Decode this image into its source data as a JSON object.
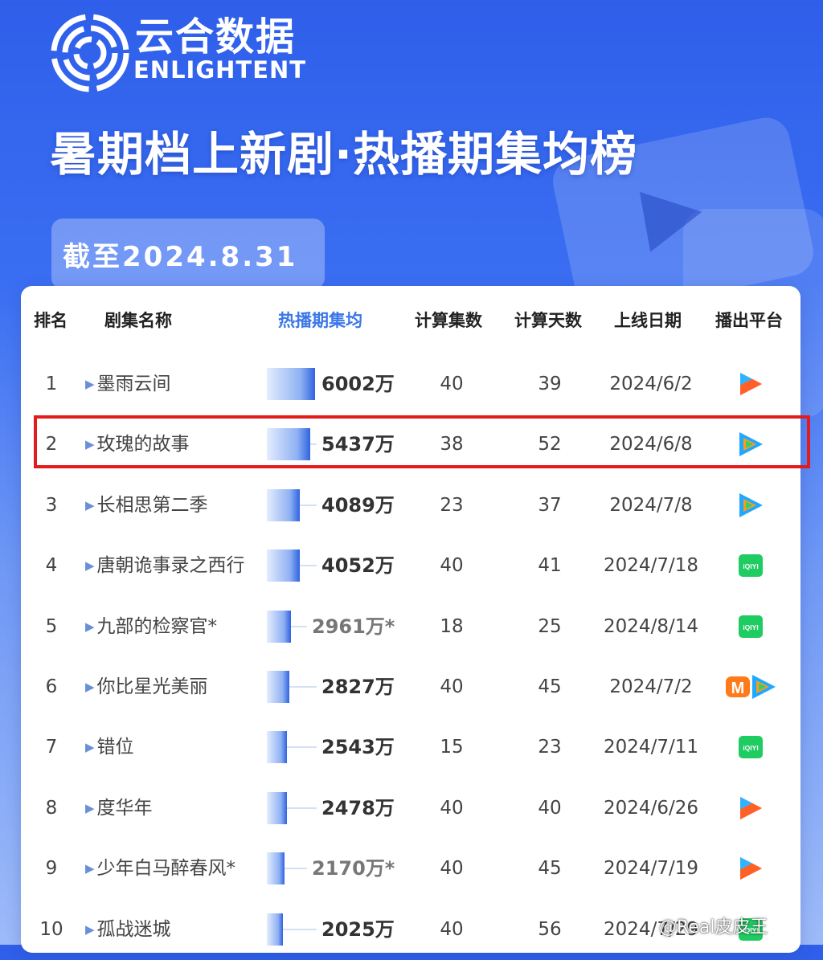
{
  "header": {
    "brand_cn": "云合数据",
    "brand_en": "ENLIGHTENT",
    "title": "暑期档上新剧·热播期集均榜",
    "date": "截至2024.8.31"
  },
  "columns": [
    "排名",
    "剧集名称",
    "热播期集均",
    "计算集数",
    "计算天数",
    "上线日期",
    "播出平台"
  ],
  "chart_data": {
    "type": "bar",
    "title": "暑期档上新剧·热播期集均榜",
    "value_column": "热播期集均",
    "unit": "万",
    "categories": [
      "墨雨云间",
      "玫瑰的故事",
      "长相思第二季",
      "唐朝诡事录之西行",
      "九部的检察官*",
      "你比星光美丽",
      "错位",
      "度华年",
      "少年白马醉春风*",
      "孤战迷城"
    ],
    "values": [
      6002,
      5437,
      4089,
      4052,
      2961,
      2827,
      2543,
      2478,
      2170,
      2025
    ],
    "value_labels": [
      "6002万",
      "5437万",
      "4089万",
      "4052万",
      "2961万*",
      "2827万",
      "2543万",
      "2478万",
      "2170万*",
      "2025万"
    ],
    "estimated": [
      false,
      false,
      false,
      false,
      true,
      false,
      false,
      false,
      true,
      false
    ],
    "ylim": [
      0,
      6002
    ]
  },
  "rows": [
    {
      "rank": "1",
      "name": "墨雨云间",
      "episodes": "40",
      "days": "39",
      "date": "2024/6/2",
      "platforms": [
        "youku"
      ]
    },
    {
      "rank": "2",
      "name": "玫瑰的故事",
      "episodes": "38",
      "days": "52",
      "date": "2024/6/8",
      "platforms": [
        "tencent"
      ]
    },
    {
      "rank": "3",
      "name": "长相思第二季",
      "episodes": "23",
      "days": "37",
      "date": "2024/7/8",
      "platforms": [
        "tencent"
      ]
    },
    {
      "rank": "4",
      "name": "唐朝诡事录之西行",
      "episodes": "40",
      "days": "41",
      "date": "2024/7/18",
      "platforms": [
        "iqiyi"
      ]
    },
    {
      "rank": "5",
      "name": "九部的检察官*",
      "episodes": "18",
      "days": "25",
      "date": "2024/8/14",
      "platforms": [
        "iqiyi"
      ]
    },
    {
      "rank": "6",
      "name": "你比星光美丽",
      "episodes": "40",
      "days": "45",
      "date": "2024/7/2",
      "platforms": [
        "mgtv",
        "tencent"
      ]
    },
    {
      "rank": "7",
      "name": "错位",
      "episodes": "15",
      "days": "23",
      "date": "2024/7/11",
      "platforms": [
        "iqiyi"
      ]
    },
    {
      "rank": "8",
      "name": "度华年",
      "episodes": "40",
      "days": "40",
      "date": "2024/6/26",
      "platforms": [
        "youku"
      ]
    },
    {
      "rank": "9",
      "name": "少年白马醉春风*",
      "episodes": "40",
      "days": "45",
      "date": "2024/7/19",
      "platforms": [
        "youku"
      ]
    },
    {
      "rank": "10",
      "name": "孤战迷城",
      "episodes": "40",
      "days": "56",
      "date": "2024/7/29",
      "platforms": [
        "iqiyi"
      ]
    }
  ],
  "platform_icons": {
    "youku": "youku-icon",
    "tencent": "tencent-video-icon",
    "iqiyi": "iqiyi-icon",
    "mgtv": "mgtv-icon"
  },
  "iqiyi_label": "iQIYI",
  "mgtv_label": "M",
  "colors": {
    "accent": "#3b77e8",
    "highlight": "#e21c1c",
    "iqiyi": "#1fcc62"
  },
  "watermark": "@Real皮皮王",
  "highlight_rank": "2"
}
